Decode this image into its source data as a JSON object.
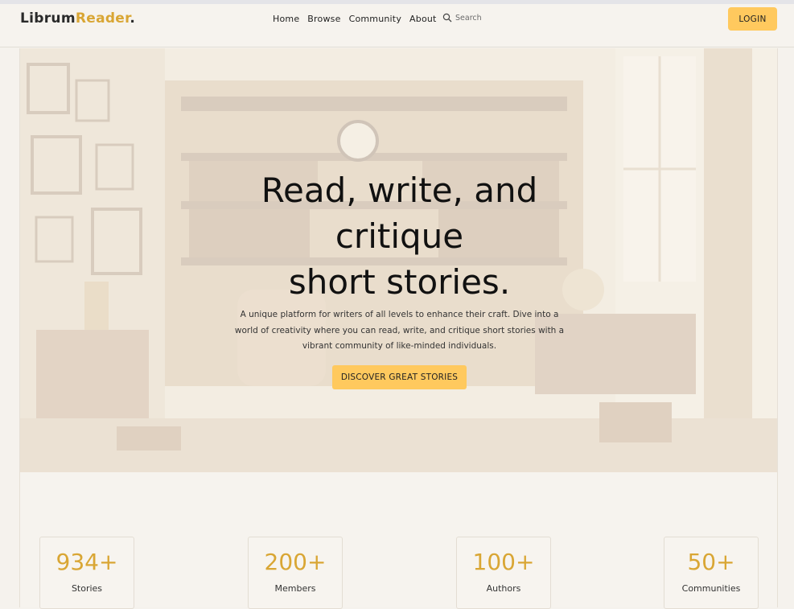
{
  "brand": {
    "part1": "Librum",
    "part2": "Reader",
    "part3": "."
  },
  "nav": {
    "links": [
      "Home",
      "Browse",
      "Community",
      "About"
    ],
    "search_placeholder": "Search",
    "login_label": "LOGIN"
  },
  "hero": {
    "title_lines": [
      "Read, write, and",
      "critique",
      "short stories."
    ],
    "description": "A unique platform for writers of all levels to enhance their craft. Dive into a world of creativity where you can read, write, and critique short stories with a vibrant community of like-minded individuals.",
    "cta_label": "DISCOVER GREAT STORIES"
  },
  "stats": [
    {
      "value": "934+",
      "label": "Stories"
    },
    {
      "value": "200+",
      "label": "Members"
    },
    {
      "value": "100+",
      "label": "Authors"
    },
    {
      "value": "50+",
      "label": "Communities"
    }
  ],
  "colors": {
    "accent": "#d9a634",
    "button": "#ffc95e",
    "background": "#f5f2ed"
  }
}
